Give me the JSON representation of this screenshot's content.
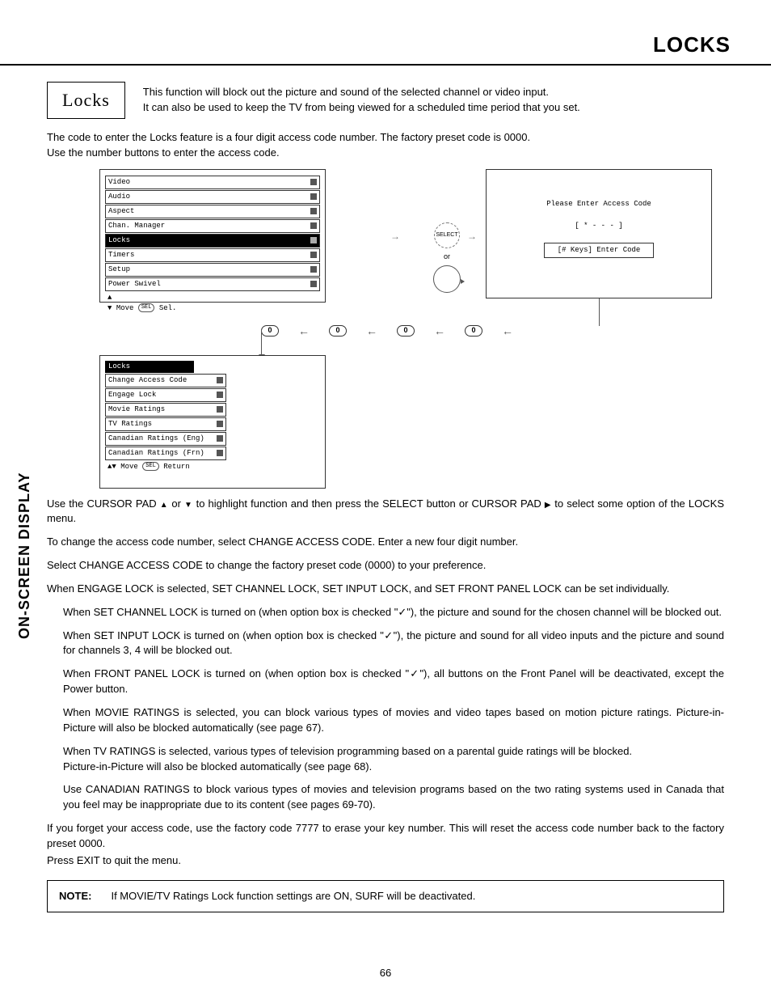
{
  "header": {
    "title": "LOCKS"
  },
  "sideTab": "ON-SCREEN DISPLAY",
  "pageNumber": "66",
  "badge": "Locks",
  "intro": {
    "line1": "This function will block out the picture and sound of the selected channel or video input.",
    "line2": "It can also be used to keep the TV from being viewed for a scheduled time period that you set."
  },
  "access": {
    "line1": "The code to enter the Locks feature is a four digit access code number.  The factory preset code is 0000.",
    "line2": "Use the number buttons to enter the access code."
  },
  "osdMenu": {
    "items": [
      {
        "label": "Video",
        "sel": false
      },
      {
        "label": "Audio",
        "sel": false
      },
      {
        "label": "Aspect",
        "sel": false
      },
      {
        "label": "Chan. Manager",
        "sel": false
      },
      {
        "label": "Locks",
        "sel": true
      },
      {
        "label": "Timers",
        "sel": false
      },
      {
        "label": "Setup",
        "sel": false
      },
      {
        "label": "Power Swivel",
        "sel": false
      }
    ],
    "hintMove": "Move",
    "hintSel": "Sel.",
    "hintSelKey": "SEL"
  },
  "remote": {
    "select": "SELECT",
    "or": "or"
  },
  "codePanel": {
    "title": "Please Enter Access Code",
    "mask": "[ * - - - ]",
    "hint": "[# Keys] Enter Code"
  },
  "zeros": [
    "0",
    "0",
    "0",
    "0"
  ],
  "locksSubmenu": {
    "title": "Locks",
    "items": [
      "Change Access Code",
      "Engage Lock",
      "Movie Ratings",
      "TV Ratings",
      "Canadian Ratings (Eng)",
      "Canadian Ratings (Frn)"
    ],
    "hintMove": "Move",
    "hintReturn": "Return",
    "hintSelKey": "SEL"
  },
  "body": {
    "cursor1a": "Use the CURSOR PAD ",
    "cursor1b": " or ",
    "cursor1c": " to highlight function and then press the SELECT button or CURSOR PAD ",
    "cursor1d": " to select some option of the LOCKS menu.",
    "change1": "To change the access code number, select CHANGE ACCESS CODE.  Enter a new four digit number.",
    "change2": "Select CHANGE ACCESS CODE to change the factory preset code (0000) to your preference.",
    "engage": "When ENGAGE LOCK is selected, SET CHANNEL LOCK, SET INPUT LOCK, and SET FRONT PANEL LOCK can be set individually.",
    "schla": "When SET CHANNEL LOCK is turned on (when option box is checked \"",
    "schlb": "\"), the picture and sound for the chosen channel will be blocked out.",
    "sila": "When SET INPUT LOCK is turned on (when option box is checked \"",
    "silb": "\"), the picture and sound for all video inputs and the picture and sound for channels 3, 4 will be blocked out.",
    "fpla": "When FRONT PANEL LOCK is turned on (when option box is checked \"",
    "fplb": "\"), all buttons on the Front Panel will be deactivated, except the Power button.",
    "movie": "When MOVIE RATINGS is selected, you can block various types of movies and video tapes based on motion picture ratings.  Picture-in-Picture will also be blocked automatically (see page 67).",
    "tv1": "When TV RATINGS is selected, various types of television programming based on a parental guide ratings will be blocked.",
    "tv2": "Picture-in-Picture will also be blocked automatically (see page 68).",
    "canada": "Use CANADIAN RATINGS to block various types of movies and television programs based on the two rating systems used in Canada that you feel may be inappropriate due to its content (see pages 69-70).",
    "forgot": "If you forget your access code, use the factory code 7777 to erase your key number. This will reset the access code number back to the factory preset 0000.",
    "exit": "Press EXIT to quit the menu."
  },
  "note": {
    "label": "NOTE:",
    "text": "If MOVIE/TV Ratings Lock function settings are ON, SURF will be deactivated."
  }
}
